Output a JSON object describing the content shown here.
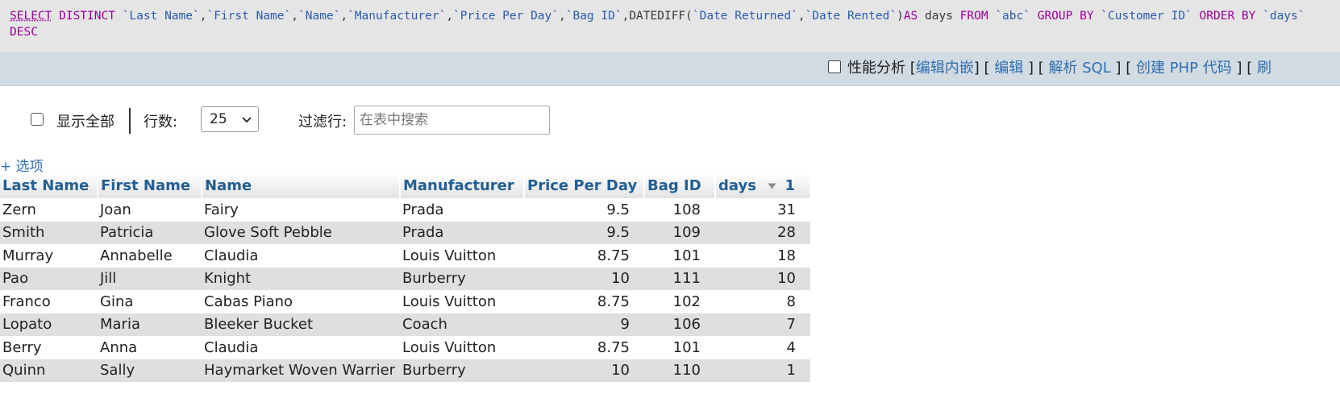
{
  "sql": {
    "tokens": [
      {
        "t": "SELECT",
        "c": "kw first"
      },
      {
        "t": " ",
        "c": ""
      },
      {
        "t": "DISTINCT",
        "c": "kw"
      },
      {
        "t": " ",
        "c": ""
      },
      {
        "t": "`Last Name`",
        "c": "str"
      },
      {
        "t": ",",
        "c": "sym"
      },
      {
        "t": "`First Name`",
        "c": "str"
      },
      {
        "t": ",",
        "c": "sym"
      },
      {
        "t": "`Name`",
        "c": "str"
      },
      {
        "t": ",",
        "c": "sym"
      },
      {
        "t": "`Manufacturer`",
        "c": "str"
      },
      {
        "t": ",",
        "c": "sym"
      },
      {
        "t": "`Price Per Day`",
        "c": "str"
      },
      {
        "t": ",",
        "c": "sym"
      },
      {
        "t": "`Bag ID`",
        "c": "str"
      },
      {
        "t": ",",
        "c": "sym"
      },
      {
        "t": "DATEDIFF",
        "c": "sym"
      },
      {
        "t": "(",
        "c": "sym"
      },
      {
        "t": "`Date Returned`",
        "c": "str"
      },
      {
        "t": ",",
        "c": "sym"
      },
      {
        "t": "`Date Rented`",
        "c": "str"
      },
      {
        "t": ")",
        "c": "sym"
      },
      {
        "t": "AS",
        "c": "kw"
      },
      {
        "t": " days ",
        "c": "sym"
      },
      {
        "t": "FROM",
        "c": "kw"
      },
      {
        "t": " ",
        "c": ""
      },
      {
        "t": "`abc`",
        "c": "str"
      },
      {
        "t": " ",
        "c": ""
      },
      {
        "t": "GROUP BY",
        "c": "kw"
      },
      {
        "t": " ",
        "c": ""
      },
      {
        "t": "`Customer ID`",
        "c": "str"
      },
      {
        "t": " ",
        "c": ""
      },
      {
        "t": "ORDER BY",
        "c": "kw"
      },
      {
        "t": " ",
        "c": ""
      },
      {
        "t": "`days`",
        "c": "str"
      },
      {
        "t": "\n",
        "c": ""
      },
      {
        "t": "DESC",
        "c": "kw"
      }
    ]
  },
  "toolbar": {
    "profiling_label": "性能分析",
    "open": " [",
    "close": "]",
    "sep": " [ ",
    "sep_close": " ]",
    "edit_inline": "编辑内嵌",
    "edit": "编辑",
    "explain_sql": "解析 SQL",
    "create_php": "创建 PHP 代码",
    "refresh_partial": "刷"
  },
  "controls": {
    "show_all": "显示全部",
    "rows_label": "行数:",
    "rows_value": "25",
    "filter_label": "过滤行:",
    "filter_placeholder": "在表中搜索"
  },
  "options_link": "+ 选项",
  "table": {
    "columns": [
      "Last Name",
      "First Name",
      "Name",
      "Manufacturer",
      "Price Per Day",
      "Bag ID",
      "days"
    ],
    "sort_order_number": "1",
    "rows": [
      [
        "Zern",
        "Joan",
        "Fairy",
        "Prada",
        "9.5",
        "108",
        "31"
      ],
      [
        "Smith",
        "Patricia",
        "Glove Soft Pebble",
        "Prada",
        "9.5",
        "109",
        "28"
      ],
      [
        "Murray",
        "Annabelle",
        "Claudia",
        "Louis Vuitton",
        "8.75",
        "101",
        "18"
      ],
      [
        "Pao",
        "Jill",
        "Knight",
        "Burberry",
        "10",
        "111",
        "10"
      ],
      [
        "Franco",
        "Gina",
        "Cabas Piano",
        "Louis Vuitton",
        "8.75",
        "102",
        "8"
      ],
      [
        "Lopato",
        "Maria",
        "Bleeker Bucket",
        "Coach",
        "9",
        "106",
        "7"
      ],
      [
        "Berry",
        "Anna",
        "Claudia",
        "Louis Vuitton",
        "8.75",
        "101",
        "4"
      ],
      [
        "Quinn",
        "Sally",
        "Haymarket Woven Warrier",
        "Burberry",
        "10",
        "110",
        "1"
      ]
    ]
  },
  "icons": {
    "sort": "sort-descending-icon",
    "chevron": "chevron-down-icon"
  }
}
